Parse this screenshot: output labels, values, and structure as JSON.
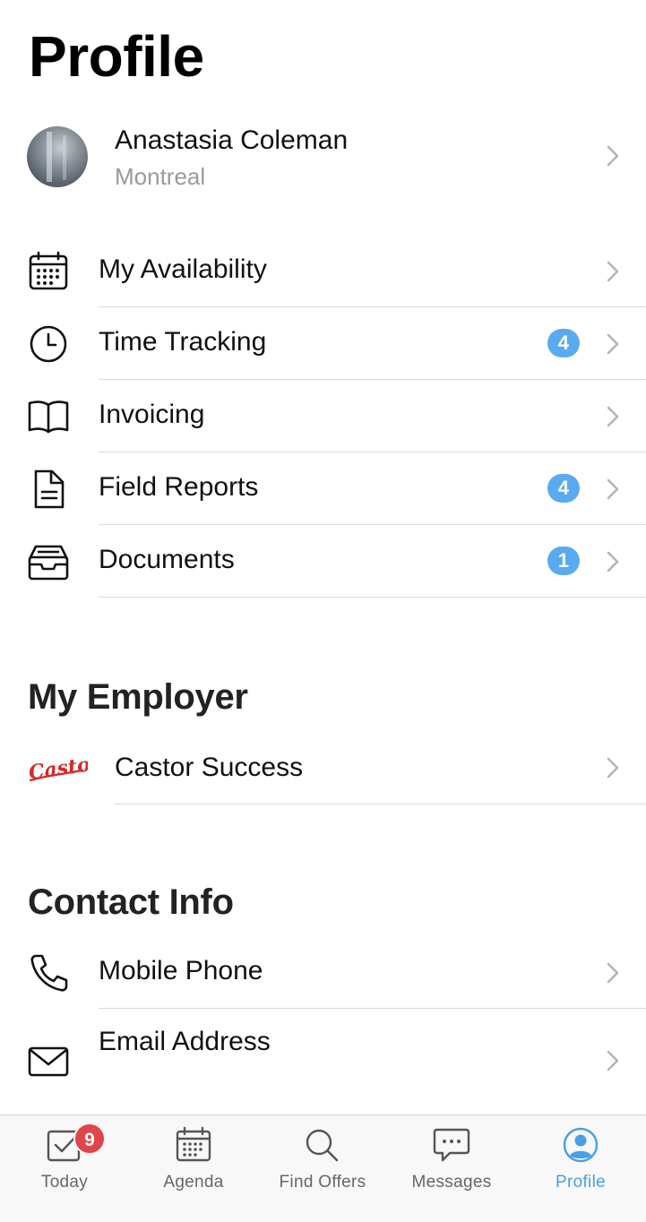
{
  "page": {
    "title": "Profile"
  },
  "profile": {
    "name": "Anastasia Coleman",
    "city": "Montreal"
  },
  "menu": [
    {
      "label": "My Availability",
      "icon": "calendar-icon",
      "badge": null
    },
    {
      "label": "Time Tracking",
      "icon": "clock-icon",
      "badge": "4"
    },
    {
      "label": "Invoicing",
      "icon": "book-icon",
      "badge": null
    },
    {
      "label": "Field Reports",
      "icon": "document-icon",
      "badge": "4"
    },
    {
      "label": "Documents",
      "icon": "inbox-icon",
      "badge": "1"
    }
  ],
  "employer": {
    "section_title": "My Employer",
    "name": "Castor Success",
    "logo_text": "Castor"
  },
  "contact": {
    "section_title": "Contact Info",
    "items": [
      {
        "label": "Mobile Phone",
        "icon": "phone-icon"
      },
      {
        "label": "Email Address",
        "icon": "envelope-icon"
      }
    ]
  },
  "tabbar": {
    "tabs": [
      {
        "label": "Today",
        "icon": "checkbox-icon",
        "badge": "9",
        "active": false
      },
      {
        "label": "Agenda",
        "icon": "calendar-icon",
        "active": false
      },
      {
        "label": "Find Offers",
        "icon": "search-icon",
        "active": false
      },
      {
        "label": "Messages",
        "icon": "chat-icon",
        "active": false
      },
      {
        "label": "Profile",
        "icon": "user-circle-icon",
        "active": true
      }
    ]
  },
  "colors": {
    "accent": "#4a9fe6",
    "badge_blue": "#5aaaf0",
    "badge_red": "#e0454b",
    "logo_red": "#d42a2a"
  }
}
